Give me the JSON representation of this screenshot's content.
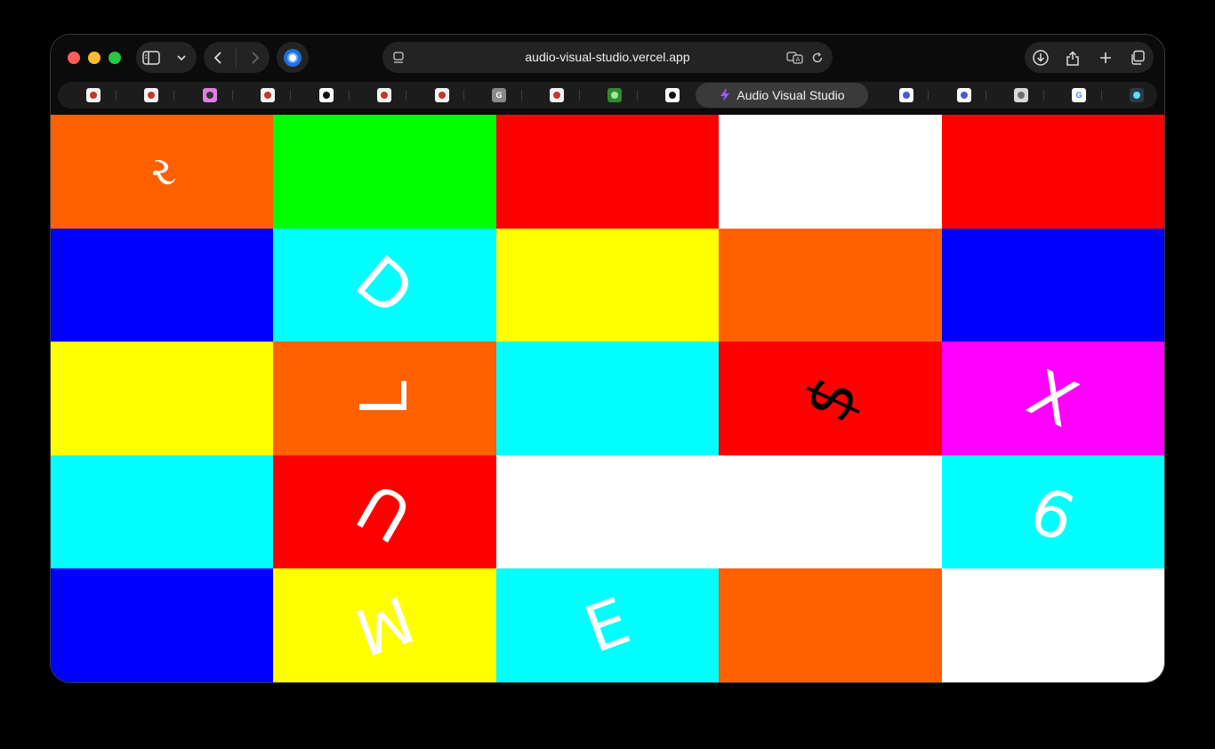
{
  "browser": {
    "url": "audio-visual-studio.vercel.app",
    "active_tab_title": "Audio Visual Studio",
    "toolbar_icons": [
      "sidebar-icon",
      "chevron-down-icon",
      "back-icon",
      "forward-icon",
      "extension-icon",
      "reader-icon",
      "translate-icon",
      "reload-icon",
      "download-icon",
      "share-icon",
      "new-tab-icon",
      "tabs-overview-icon"
    ]
  },
  "favorites": [
    {
      "name": "fav-1",
      "icon": "globe-icon",
      "bg": "#f4f4f4",
      "fg": "#c0392b",
      "text": ""
    },
    {
      "name": "fav-2",
      "icon": "globe-icon",
      "bg": "#f4f4f4",
      "fg": "#c0392b",
      "text": ""
    },
    {
      "name": "fav-3",
      "icon": "feed-icon",
      "bg": "#e080e0",
      "fg": "#333333",
      "text": ""
    },
    {
      "name": "fav-4",
      "icon": "globe-icon",
      "bg": "#f4f4f4",
      "fg": "#c0392b",
      "text": ""
    },
    {
      "name": "fav-5",
      "icon": "book-icon",
      "bg": "#ffffff",
      "fg": "#111111",
      "text": ""
    },
    {
      "name": "fav-6",
      "icon": "globe-icon",
      "bg": "#f4f4f4",
      "fg": "#c0392b",
      "text": ""
    },
    {
      "name": "fav-7",
      "icon": "globe-icon",
      "bg": "#f4f4f4",
      "fg": "#c0392b",
      "text": ""
    },
    {
      "name": "fav-8",
      "icon": "letter-g-icon",
      "bg": "#8a8a8a",
      "fg": "#ffffff",
      "text": "G"
    },
    {
      "name": "fav-9",
      "icon": "globe-icon",
      "bg": "#f4f4f4",
      "fg": "#c0392b",
      "text": ""
    },
    {
      "name": "fav-10",
      "icon": "pixel-icon",
      "bg": "#2e8b2e",
      "fg": "#a6e3a1",
      "text": ""
    },
    {
      "name": "fav-11",
      "icon": "cube-icon",
      "bg": "#ffffff",
      "fg": "#111111",
      "text": ""
    },
    {
      "name": "fav-13",
      "icon": "whale-icon",
      "bg": "#ffffff",
      "fg": "#4a5bd6",
      "text": ""
    },
    {
      "name": "fav-14",
      "icon": "whale-icon",
      "bg": "#ffffff",
      "fg": "#4a5bd6",
      "text": ""
    },
    {
      "name": "fav-15",
      "icon": "github-icon",
      "bg": "#d8d8d8",
      "fg": "#6e6e6e",
      "text": ""
    },
    {
      "name": "fav-16",
      "icon": "google-icon",
      "bg": "#ffffff",
      "fg": "#4285f4",
      "text": "G"
    },
    {
      "name": "fav-17",
      "icon": "react-icon",
      "bg": "#2a3a44",
      "fg": "#61dafb",
      "text": ""
    }
  ],
  "grid": {
    "rows": 5,
    "cols": 5,
    "cells": [
      {
        "color": "#ff6000",
        "glyph": "ર",
        "glyph_color": "#ffffff",
        "rotation": -20
      },
      {
        "color": "#00ff00",
        "glyph": "",
        "glyph_color": "#ffffff",
        "rotation": 0
      },
      {
        "color": "#ff0000",
        "glyph": "",
        "glyph_color": "#ffffff",
        "rotation": 0
      },
      {
        "color": "#ffffff",
        "glyph": "",
        "glyph_color": "#ffffff",
        "rotation": 0
      },
      {
        "color": "#ff0000",
        "glyph": "",
        "glyph_color": "#ffffff",
        "rotation": 0
      },
      {
        "color": "#0000ff",
        "glyph": "",
        "glyph_color": "#ffffff",
        "rotation": 0
      },
      {
        "color": "#00ffff",
        "glyph": "D",
        "glyph_color": "#ffffff",
        "rotation": 40
      },
      {
        "color": "#ffff00",
        "glyph": "",
        "glyph_color": "#ffffff",
        "rotation": 0
      },
      {
        "color": "#ff6000",
        "glyph": "",
        "glyph_color": "#ffffff",
        "rotation": 0
      },
      {
        "color": "#0000ff",
        "glyph": "",
        "glyph_color": "#ffffff",
        "rotation": 0
      },
      {
        "color": "#ffff00",
        "glyph": "",
        "glyph_color": "#ffffff",
        "rotation": 0
      },
      {
        "color": "#ff6000",
        "glyph": "L",
        "glyph_color": "#ffffff",
        "rotation": -90
      },
      {
        "color": "#00ffff",
        "glyph": "",
        "glyph_color": "#ffffff",
        "rotation": 0
      },
      {
        "color": "#ff0000",
        "glyph": "$",
        "glyph_color": "#000000",
        "rotation": -65
      },
      {
        "color": "#ff00ff",
        "glyph": "X",
        "glyph_color": "#ffffff",
        "rotation": 25
      },
      {
        "color": "#00ffff",
        "glyph": "",
        "glyph_color": "#ffffff",
        "rotation": 0
      },
      {
        "color": "#ff0000",
        "glyph": "U",
        "glyph_color": "#ffffff",
        "rotation": 210
      },
      {
        "color": "#ffffff",
        "glyph": "",
        "glyph_color": "#ffffff",
        "rotation": 0
      },
      {
        "color": "#ffffff",
        "glyph": "",
        "glyph_color": "#ffffff",
        "rotation": 0
      },
      {
        "color": "#00ffff",
        "glyph": "9",
        "glyph_color": "#ffffff",
        "rotation": 200
      },
      {
        "color": "#0000ff",
        "glyph": "",
        "glyph_color": "#ffffff",
        "rotation": 0
      },
      {
        "color": "#ffff00",
        "glyph": "M",
        "glyph_color": "#ffffff",
        "rotation": 160
      },
      {
        "color": "#00ffff",
        "glyph": "E",
        "glyph_color": "#ffffff",
        "rotation": -20
      },
      {
        "color": "#ff6000",
        "glyph": "",
        "glyph_color": "#ffffff",
        "rotation": 0
      },
      {
        "color": "#ffffff",
        "glyph": "",
        "glyph_color": "#ffffff",
        "rotation": 0
      }
    ]
  }
}
